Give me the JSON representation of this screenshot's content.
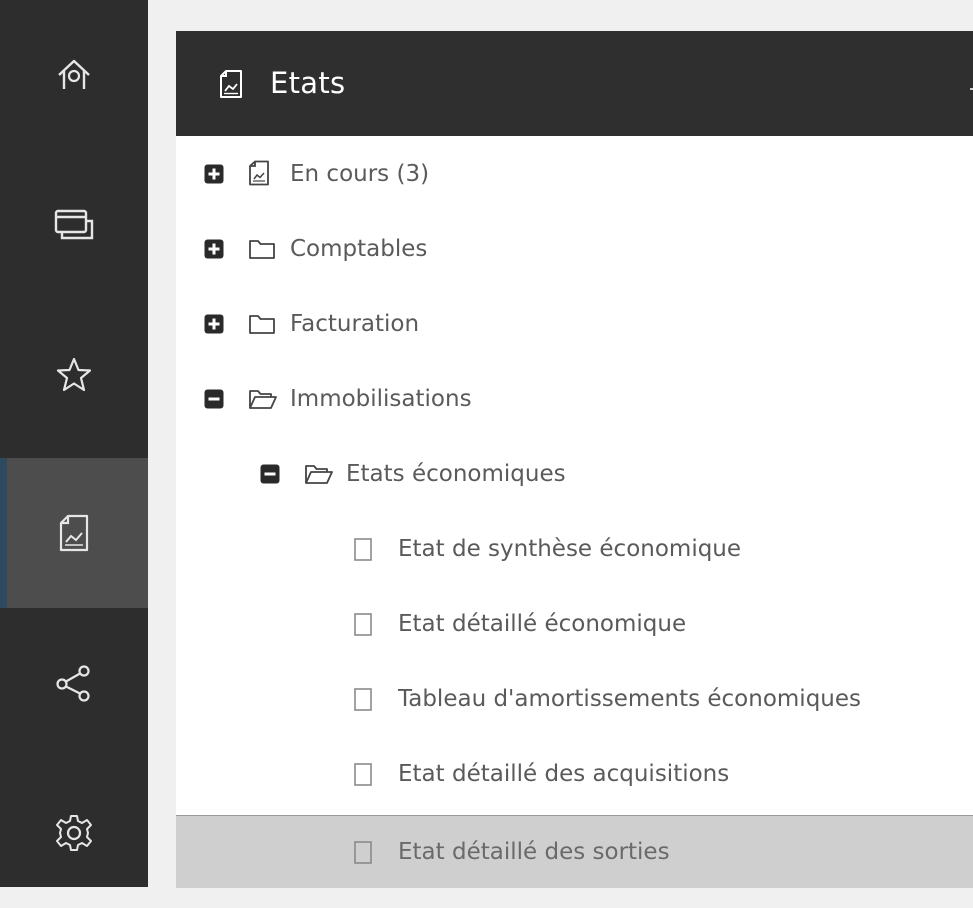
{
  "sidebar": {
    "items": [
      {
        "id": "home",
        "icon": "home-icon",
        "active": false
      },
      {
        "id": "windows",
        "icon": "windows-icon",
        "active": false
      },
      {
        "id": "favorites",
        "icon": "star-icon",
        "active": false
      },
      {
        "id": "reports",
        "icon": "report-icon",
        "active": true
      },
      {
        "id": "share",
        "icon": "share-icon",
        "active": false
      },
      {
        "id": "settings",
        "icon": "gear-icon",
        "active": false
      }
    ]
  },
  "panel": {
    "title": "Etats",
    "title_icon": "report-icon"
  },
  "tree": [
    {
      "label": "En cours (3)",
      "toggle": "plus",
      "icon": "report-icon",
      "level": 0
    },
    {
      "label": "Comptables",
      "toggle": "plus",
      "icon": "folder-icon",
      "level": 0
    },
    {
      "label": "Facturation",
      "toggle": "plus",
      "icon": "folder-icon",
      "level": 0
    },
    {
      "label": "Immobilisations",
      "toggle": "minus",
      "icon": "folder-open-icon",
      "level": 0
    },
    {
      "label": "Etats économiques",
      "toggle": "minus",
      "icon": "folder-open-icon",
      "level": 1
    },
    {
      "label": "Etat de synthèse économique",
      "toggle": "none",
      "icon": "document-icon",
      "level": 2
    },
    {
      "label": "Etat détaillé économique",
      "toggle": "none",
      "icon": "document-icon",
      "level": 2
    },
    {
      "label": "Tableau d'amortissements économiques",
      "toggle": "none",
      "icon": "document-icon",
      "level": 2
    },
    {
      "label": "Etat détaillé des acquisitions",
      "toggle": "none",
      "icon": "document-icon",
      "level": 2
    },
    {
      "label": "Etat détaillé des sorties",
      "toggle": "none",
      "icon": "document-icon",
      "level": 2,
      "selected": true
    }
  ]
}
